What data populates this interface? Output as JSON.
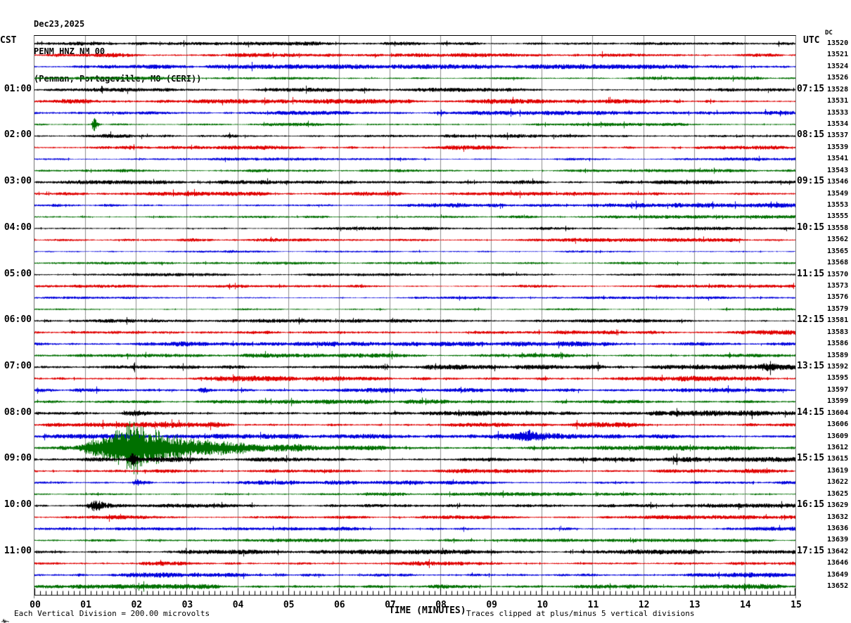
{
  "header": {
    "date": "Dec23,2025",
    "station": "PENM HNZ NM 00",
    "location": "(Penman, Portageville, MO (CERI))"
  },
  "axes": {
    "left_header": "CST",
    "right_header": "UTC",
    "dc_label": "DC",
    "xlabel": "TIME (MINUTES)",
    "minute_labels": [
      "00",
      "01",
      "02",
      "03",
      "04",
      "05",
      "06",
      "07",
      "08",
      "09",
      "10",
      "11",
      "12",
      "13",
      "14",
      "15"
    ]
  },
  "footer": {
    "scale": "Each Vertical Division =  200.00 microvolts",
    "clip_note": "Traces clipped at plus/minus 5 vertical divisions"
  },
  "left_labels": [
    "01:00",
    "02:00",
    "03:00",
    "04:00",
    "05:00",
    "06:00",
    "07:00",
    "08:00",
    "09:00",
    "10:00",
    "11:00"
  ],
  "right_labels": [
    "07:15",
    "08:15",
    "09:15",
    "10:15",
    "11:15",
    "12:15",
    "13:15",
    "14:15",
    "15:15",
    "16:15",
    "17:15"
  ],
  "chart_data": {
    "type": "line",
    "title": "PENM HNZ NM 00 helicorder seismogram",
    "x_axis": {
      "label": "TIME (MINUTES)",
      "range": [
        0,
        15
      ],
      "major_tick_minutes": 1
    },
    "minutes_per_line": 15,
    "vertical_division_microvolts": 200.0,
    "clip_divisions": 5,
    "left_time_zone": "CST",
    "right_time_zone": "UTC",
    "trace_colors": {
      "black": "#000000",
      "red": "#e00000",
      "blue": "#0000dd",
      "green": "#007000"
    },
    "color_cycle": [
      "black",
      "red",
      "blue",
      "green"
    ],
    "grid_color": "#8c8c8c",
    "rows": [
      {
        "channel": 13520,
        "amp": 1.5
      },
      {
        "channel": 13521,
        "amp": 1.6
      },
      {
        "channel": 13524,
        "amp": 1.8
      },
      {
        "channel": 13526,
        "amp": 1.2
      },
      {
        "channel": 13528,
        "amp": 1.5
      },
      {
        "channel": 13531,
        "amp": 1.8
      },
      {
        "channel": 13533,
        "amp": 1.6
      },
      {
        "channel": 13534,
        "amp": 1.3
      },
      {
        "channel": 13537,
        "amp": 1.5
      },
      {
        "channel": 13539,
        "amp": 1.7
      },
      {
        "channel": 13541,
        "amp": 1.2
      },
      {
        "channel": 13543,
        "amp": 1.2
      },
      {
        "channel": 13546,
        "amp": 1.5
      },
      {
        "channel": 13549,
        "amp": 1.5
      },
      {
        "channel": 13553,
        "amp": 1.7
      },
      {
        "channel": 13555,
        "amp": 1.3
      },
      {
        "channel": 13558,
        "amp": 1.3
      },
      {
        "channel": 13562,
        "amp": 1.4
      },
      {
        "channel": 13565,
        "amp": 1.0
      },
      {
        "channel": 13568,
        "amp": 1.0
      },
      {
        "channel": 13570,
        "amp": 1.2
      },
      {
        "channel": 13573,
        "amp": 1.2
      },
      {
        "channel": 13576,
        "amp": 1.0
      },
      {
        "channel": 13579,
        "amp": 1.0
      },
      {
        "channel": 13581,
        "amp": 1.4
      },
      {
        "channel": 13583,
        "amp": 1.8
      },
      {
        "channel": 13586,
        "amp": 2.0
      },
      {
        "channel": 13589,
        "amp": 1.6
      },
      {
        "channel": 13592,
        "amp": 1.9
      },
      {
        "channel": 13595,
        "amp": 2.1
      },
      {
        "channel": 13597,
        "amp": 2.0
      },
      {
        "channel": 13599,
        "amp": 1.7
      },
      {
        "channel": 13604,
        "amp": 2.1
      },
      {
        "channel": 13606,
        "amp": 2.0
      },
      {
        "channel": 13609,
        "amp": 1.9
      },
      {
        "channel": 13612,
        "amp": 2.0
      },
      {
        "channel": 13615,
        "amp": 1.9
      },
      {
        "channel": 13619,
        "amp": 1.8
      },
      {
        "channel": 13622,
        "amp": 1.7
      },
      {
        "channel": 13625,
        "amp": 1.4
      },
      {
        "channel": 13629,
        "amp": 1.6
      },
      {
        "channel": 13632,
        "amp": 1.5
      },
      {
        "channel": 13636,
        "amp": 1.5
      },
      {
        "channel": 13639,
        "amp": 1.3
      },
      {
        "channel": 13642,
        "amp": 1.8
      },
      {
        "channel": 13646,
        "amp": 1.8
      },
      {
        "channel": 13649,
        "amp": 1.9
      },
      {
        "channel": 13652,
        "amp": 1.9
      }
    ],
    "events": [
      {
        "row": 5,
        "start": 0.1,
        "peak": 1.0,
        "end": 1.7,
        "amp": 3,
        "note": "minor noise burst"
      },
      {
        "row": 7,
        "start": 1.1,
        "peak": 1.18,
        "end": 1.32,
        "amp": 14,
        "note": "sharp spike ~min 1.2"
      },
      {
        "row": 28,
        "start": 14.2,
        "peak": 14.5,
        "end": 15.0,
        "amp": 4,
        "note": "late-line burst"
      },
      {
        "row": 30,
        "start": 3.2,
        "peak": 3.35,
        "end": 3.6,
        "amp": 5,
        "note": "small burst"
      },
      {
        "row": 32,
        "start": 1.6,
        "peak": 2.0,
        "end": 3.6,
        "amp": 3,
        "note": "elevated noise"
      },
      {
        "row": 34,
        "start": 9.3,
        "peak": 9.7,
        "end": 11.0,
        "amp": 6,
        "note": "burst ~min 9.7"
      },
      {
        "row": 35,
        "start": 0.85,
        "peak": 1.95,
        "end": 5.3,
        "amp": 40,
        "note": "large clipped event ~min 2"
      },
      {
        "row": 36,
        "start": 1.3,
        "peak": 2.5,
        "end": 4.5,
        "amp": 3,
        "note": "coda noise"
      },
      {
        "row": 36,
        "start": 1.85,
        "peak": 1.95,
        "end": 2.15,
        "amp": 11,
        "note": "spike under large event"
      },
      {
        "row": 38,
        "start": 1.9,
        "peak": 2.0,
        "end": 2.4,
        "amp": 5,
        "note": "small burst"
      },
      {
        "row": 40,
        "start": 1.0,
        "peak": 1.2,
        "end": 1.9,
        "amp": 9,
        "note": "burst ~min 1.2"
      }
    ]
  }
}
